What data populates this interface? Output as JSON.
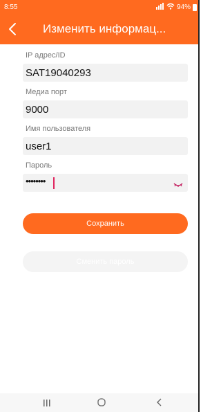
{
  "status_bar": {
    "time": "8:55",
    "battery": "94%"
  },
  "app_bar": {
    "title": "Изменить информац..."
  },
  "form": {
    "ip_label": "IP адрес/ID",
    "ip_value": "SAT19040293",
    "port_label": "Медиа порт",
    "port_value": "9000",
    "user_label": "Имя пользователя",
    "user_value": "user1",
    "password_label": "Пароль",
    "password_masked": "••••••••"
  },
  "buttons": {
    "save": "Сохранить",
    "change_password": "Сменить пароль"
  },
  "colors": {
    "accent": "#ff6a1f",
    "caret": "#e0245e"
  },
  "icons": [
    "back-icon",
    "eye-icon",
    "signal-icon",
    "wifi-icon",
    "battery-icon",
    "nav-recent-icon",
    "nav-home-icon",
    "nav-back-icon"
  ]
}
